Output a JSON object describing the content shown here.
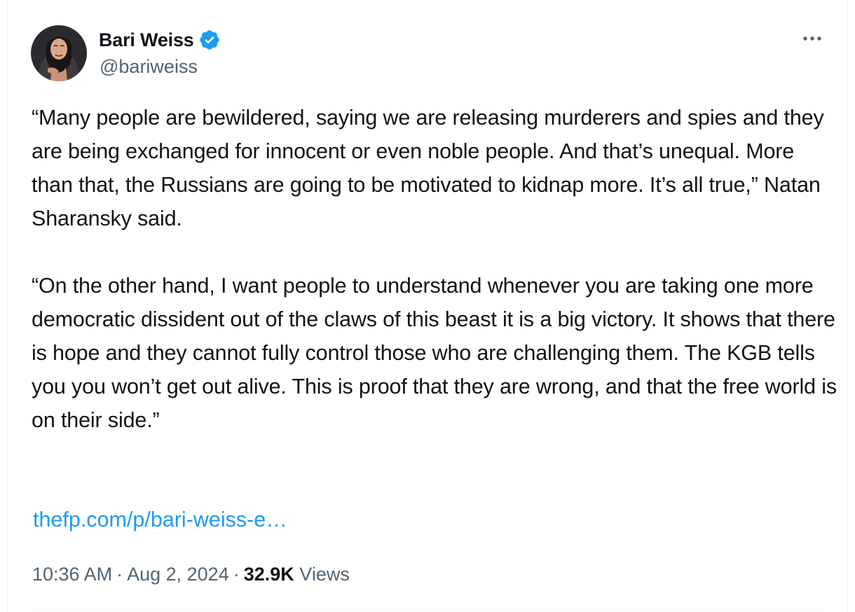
{
  "author": {
    "display_name": "Bari Weiss",
    "handle": "@bariweiss",
    "verified_icon": "verified-badge-icon",
    "avatar_icon": "profile-photo"
  },
  "menu": {
    "more_icon": "more-horizontal-icon"
  },
  "tweet": {
    "paragraphs": [
      "“Many people are bewildered, saying we are releasing murderers and spies and they are being exchanged for innocent or even noble people. And that’s unequal. More than that, the Russians are going to be motivated to kidnap more. It’s all true,” Natan Sharansky said.",
      "“On the other hand, I want people to understand whenever you are taking one more democratic dissident out of the claws of this beast it is a big victory. It shows that there is hope and they cannot fully control those who are challenging them. The KGB tells you you won’t get out alive. This is proof that they are wrong, and that the free world is on their side.”"
    ],
    "link_text": "thefp.com/p/bari-weiss-e…"
  },
  "meta": {
    "time": "10:36 AM",
    "separator": "·",
    "date": "Aug 2, 2024",
    "views_count": "32.9K",
    "views_label": "Views"
  },
  "colors": {
    "text": "#0f1419",
    "secondary": "#536471",
    "accent": "#1d9bf0",
    "border": "#eff3f4"
  }
}
